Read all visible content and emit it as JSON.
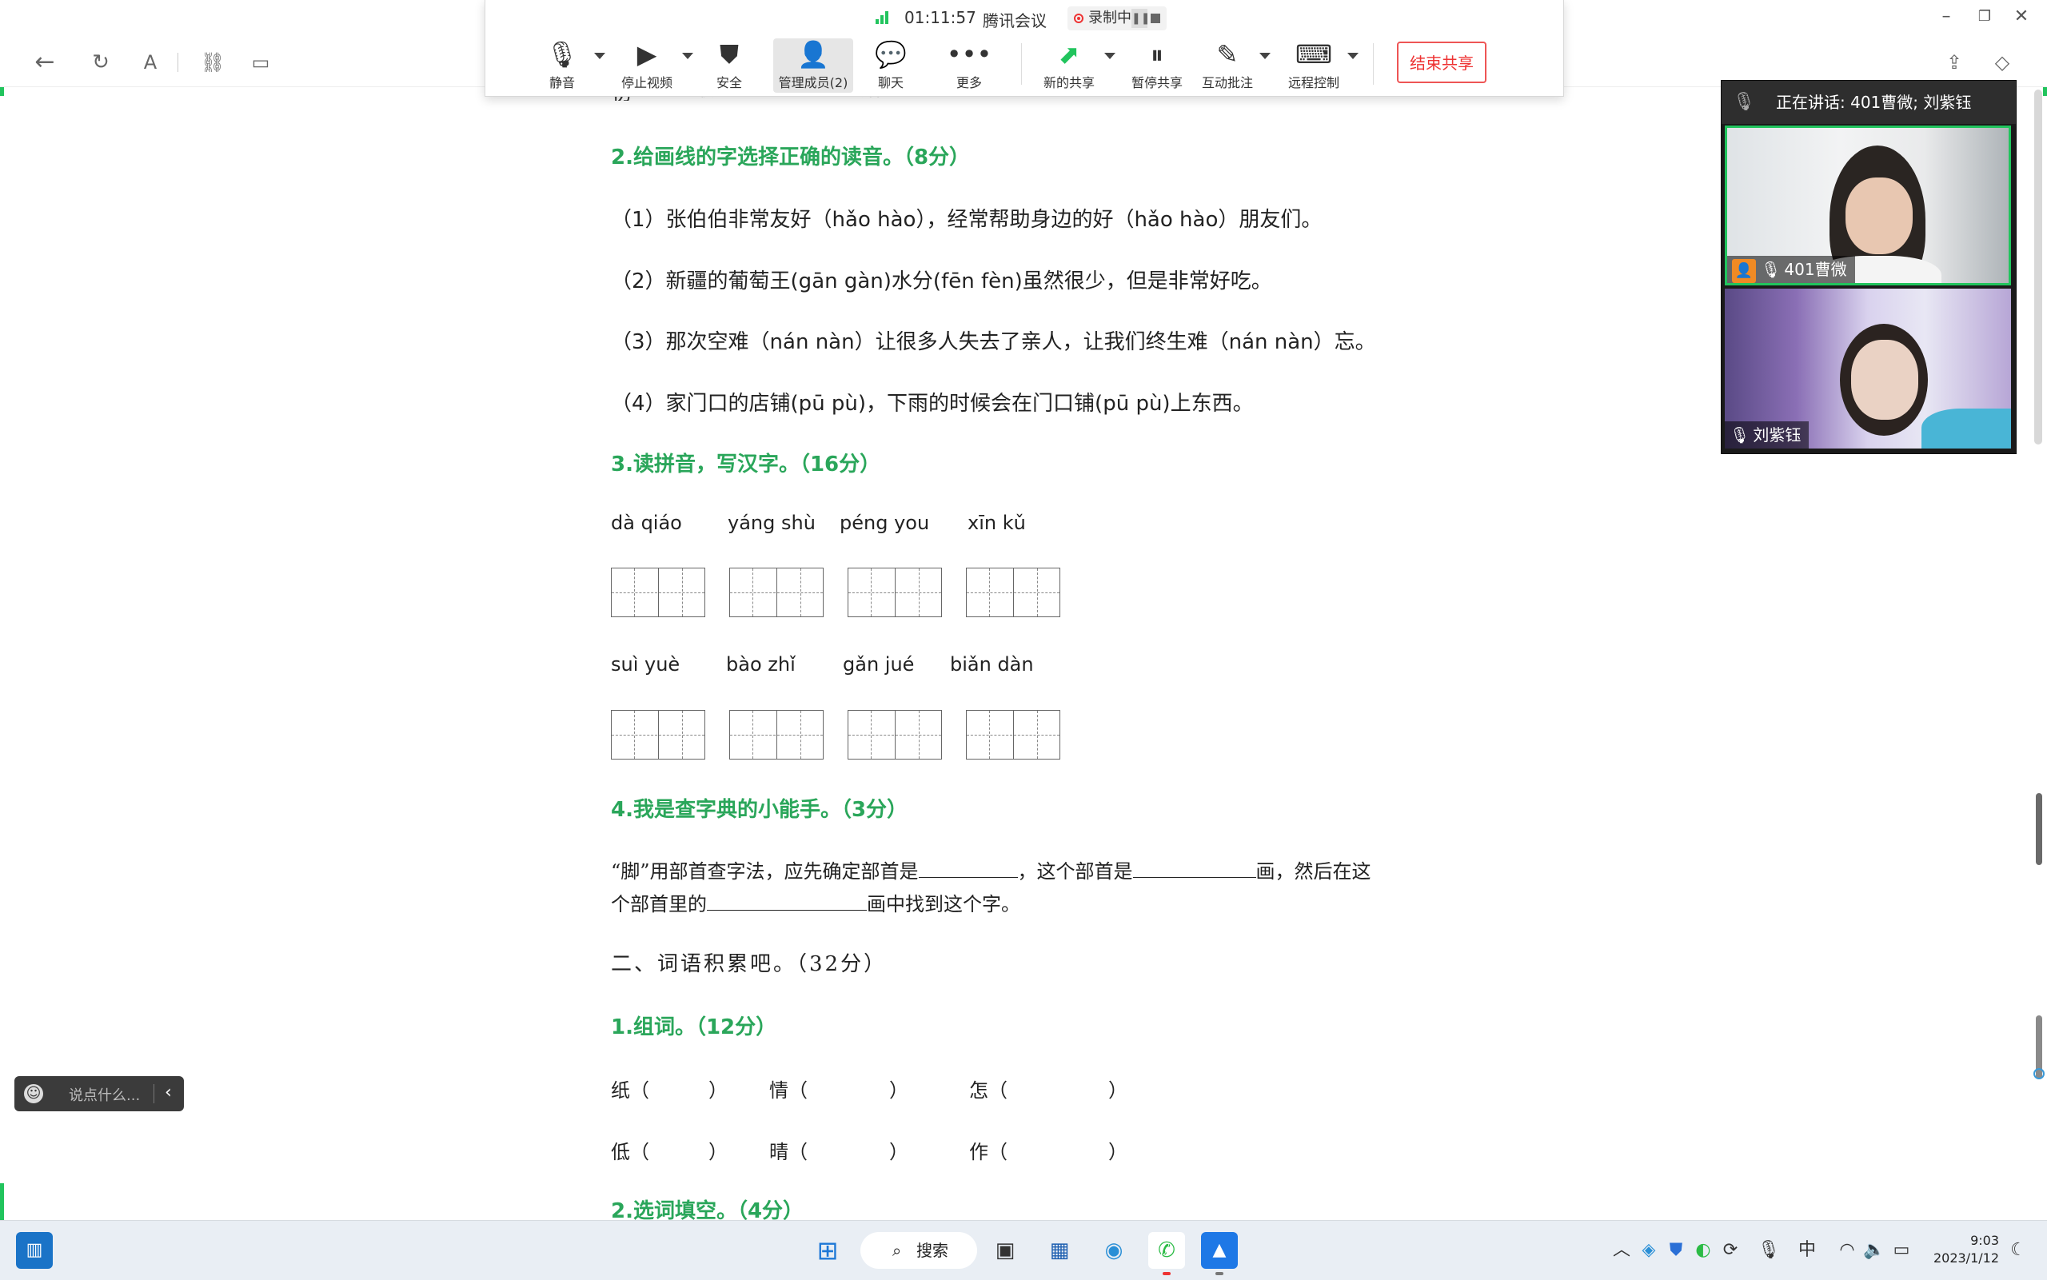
{
  "meeting": {
    "elapsed": "01:11:57",
    "app_name": "腾讯会议",
    "recording_label": "录制中",
    "tools": {
      "mute": "静音",
      "stop_video": "停止视频",
      "security": "安全",
      "manage_members": "管理成员(2)",
      "chat": "聊天",
      "more": "更多",
      "new_share": "新的共享",
      "pause_share": "暂停共享",
      "annotate": "互动批注",
      "remote_control": "远程控制"
    },
    "end_share": "结束共享"
  },
  "document": {
    "s2_title": "2.给画线的字选择正确的读音。（8分）",
    "s2_items": [
      "（1）张伯伯非常友好（hǎo  hào），经常帮助身边的好（hǎo hào）朋友们。",
      "（2）新疆的葡萄王(gān  gàn)水分(fēn fèn)虽然很少，但是非常好吃。",
      "（3）那次空难（nán  nàn）让很多人失去了亲人，让我们终生难（nán  nàn）忘。",
      "（4）家门口的店铺(pū  pù)，下雨的时候会在门口铺(pū  pù)上东西。"
    ],
    "s3_title": "3.读拼音，写汉字。（16分）",
    "pinyin_row1": [
      "dà qiáo",
      "yáng shù",
      "péng you",
      "xīn  kǔ"
    ],
    "pinyin_row2": [
      "suì  yuè",
      "bào zhǐ",
      "gǎn  jué",
      "biǎn  dàn"
    ],
    "s4_title": "4.我是查字典的小能手。（3分）",
    "s4_line1_a": "“脚”用部首查字法，应先确定部首是",
    "s4_line1_b": "，这个部首是",
    "s4_line1_c": "画，然后在这",
    "s4_line2_a": "个部首里的",
    "s4_line2_b": "画中找到这个字。",
    "part2_title": "二、词语积累吧。（32分）",
    "p2_s1_title": "1.组词。（12分）",
    "words_row1": [
      "纸（",
      "）",
      "情（",
      "）",
      "怎（",
      "）"
    ],
    "words_row2": [
      "低（",
      "）",
      "晴（",
      "）",
      "作（",
      "）"
    ],
    "p2_s2_title": "2.选词填空。（4分）"
  },
  "video_panel": {
    "speaking": "正在讲话: 401曹微; 刘紫钰",
    "p1": "401曹微",
    "p2": "刘紫钰"
  },
  "chat": {
    "placeholder": "说点什么..."
  },
  "taskbar": {
    "search": "搜索",
    "ime": "中",
    "time": "9:03",
    "date": "2023/1/12"
  },
  "colors": {
    "accent_green": "#2aa65a",
    "share_green": "#21c45d",
    "end_red": "#e33333"
  }
}
